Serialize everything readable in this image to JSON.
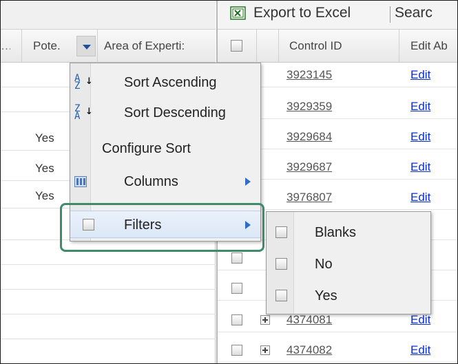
{
  "left_grid": {
    "cut_header": "…",
    "columns": [
      "Pote.",
      "Area of Experti:"
    ],
    "rows": [
      "",
      "",
      "Yes",
      "Yes",
      "Yes",
      "",
      "",
      "",
      "",
      "",
      ""
    ]
  },
  "right_grid": {
    "toolbar": {
      "export_label": "Export to Excel",
      "search_label": "Searc"
    },
    "columns": [
      "Control ID",
      "Edit Ab"
    ],
    "rows": [
      {
        "control_id": "3923145",
        "edit": "Edit"
      },
      {
        "control_id": "3929359",
        "edit": "Edit"
      },
      {
        "control_id": "3929684",
        "edit": "Edit"
      },
      {
        "control_id": "3929687",
        "edit": "Edit"
      },
      {
        "control_id": "3976807",
        "edit": "Edit"
      },
      {
        "control_id": "",
        "edit": "it"
      },
      {
        "control_id": "",
        "edit": "it"
      },
      {
        "control_id": "",
        "edit": "it"
      },
      {
        "control_id": "4374081",
        "edit": "Edit"
      },
      {
        "control_id": "4374082",
        "edit": "Edit"
      }
    ]
  },
  "menu": {
    "sort_asc": "Sort Ascending",
    "sort_desc": "Sort Descending",
    "configure_sort": "Configure Sort",
    "columns": "Columns",
    "filters": "Filters"
  },
  "filter_submenu": {
    "options": [
      "Blanks",
      "No",
      "Yes"
    ]
  },
  "colors": {
    "link": "#0a2fd1",
    "highlight_border": "#3e8b6c",
    "menu_bg": "#f0f0f0"
  }
}
